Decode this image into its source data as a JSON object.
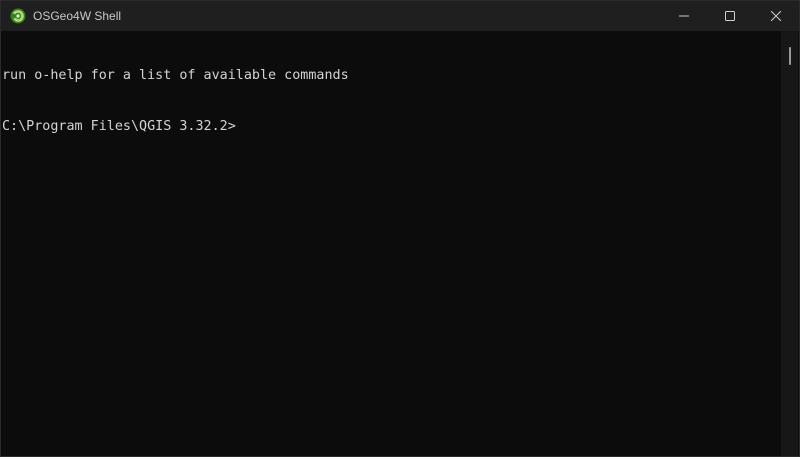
{
  "window": {
    "title": "OSGeo4W Shell",
    "app_icon": "osgeo4w-icon",
    "controls": {
      "minimize_icon": "minimize-icon",
      "maximize_icon": "maximize-icon",
      "close_icon": "close-icon"
    }
  },
  "console": {
    "lines": [
      "run o-help for a list of available commands",
      "C:\\Program Files\\QGIS 3.32.2>"
    ]
  },
  "colors": {
    "titlebar_bg": "#1f1f1f",
    "console_bg": "#0c0c0c",
    "console_text": "#d4d4d4",
    "icon_green": "#5aa832"
  }
}
